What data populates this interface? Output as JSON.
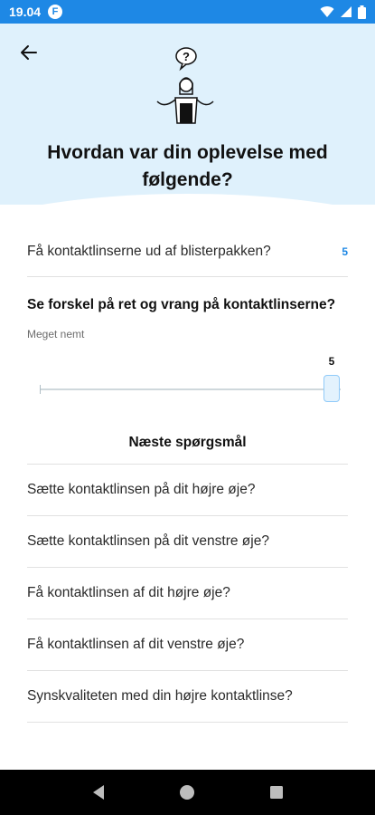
{
  "status_bar": {
    "time": "19.04",
    "app_icon_letter": "F",
    "icons": [
      "wifi-icon",
      "signal-icon",
      "battery-icon"
    ]
  },
  "header": {
    "back_icon": "arrow-left-icon",
    "illustration": "confused-person-question-illustration",
    "bubble_text": "?",
    "title": "Hvordan var din oplevelse med følgende?"
  },
  "answered": {
    "label": "Få kontaktlinserne ud af blisterpakken?",
    "score": "5"
  },
  "current_question": {
    "text": "Se forskel på ret og vrang på kontaktlinserne?",
    "caption": "Meget nemt",
    "value": "5",
    "min": 1,
    "max": 5
  },
  "next_section": {
    "heading": "Næste spørgsmål",
    "items": [
      "Sætte kontaktlinsen på dit højre øje?",
      "Sætte kontaktlinsen på dit venstre øje?",
      "Få kontaktlinsen af dit højre øje?",
      "Få kontaktlinsen af dit venstre øje?",
      "Synskvaliteten med din højre kontaktlinse?"
    ]
  },
  "nav_bar": {
    "icons": [
      "back-triangle-icon",
      "home-circle-icon",
      "recents-square-icon"
    ]
  },
  "colors": {
    "status_bar": "#1e88e5",
    "header_bg": "#dff1fc",
    "accent": "#1e88e5"
  }
}
